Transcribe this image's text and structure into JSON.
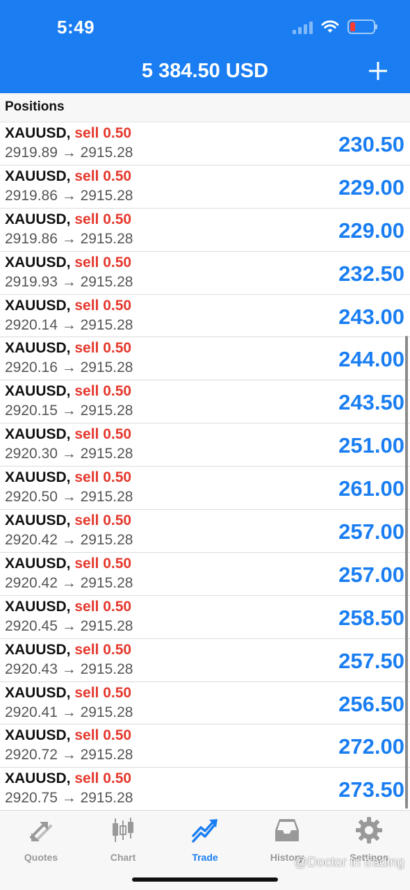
{
  "status": {
    "time": "5:49"
  },
  "header": {
    "balance": "5 384.50 USD"
  },
  "section": {
    "title": "Positions"
  },
  "positions": [
    {
      "symbol": "XAUUSD,",
      "side": "sell 0.50",
      "prices": "2919.89 → 2915.28",
      "profit": "230.50"
    },
    {
      "symbol": "XAUUSD,",
      "side": "sell 0.50",
      "prices": "2919.86 → 2915.28",
      "profit": "229.00"
    },
    {
      "symbol": "XAUUSD,",
      "side": "sell 0.50",
      "prices": "2919.86 → 2915.28",
      "profit": "229.00"
    },
    {
      "symbol": "XAUUSD,",
      "side": "sell 0.50",
      "prices": "2919.93 → 2915.28",
      "profit": "232.50"
    },
    {
      "symbol": "XAUUSD,",
      "side": "sell 0.50",
      "prices": "2920.14 → 2915.28",
      "profit": "243.00"
    },
    {
      "symbol": "XAUUSD,",
      "side": "sell 0.50",
      "prices": "2920.16 → 2915.28",
      "profit": "244.00"
    },
    {
      "symbol": "XAUUSD,",
      "side": "sell 0.50",
      "prices": "2920.15 → 2915.28",
      "profit": "243.50"
    },
    {
      "symbol": "XAUUSD,",
      "side": "sell 0.50",
      "prices": "2920.30 → 2915.28",
      "profit": "251.00"
    },
    {
      "symbol": "XAUUSD,",
      "side": "sell 0.50",
      "prices": "2920.50 → 2915.28",
      "profit": "261.00"
    },
    {
      "symbol": "XAUUSD,",
      "side": "sell 0.50",
      "prices": "2920.42 → 2915.28",
      "profit": "257.00"
    },
    {
      "symbol": "XAUUSD,",
      "side": "sell 0.50",
      "prices": "2920.42 → 2915.28",
      "profit": "257.00"
    },
    {
      "symbol": "XAUUSD,",
      "side": "sell 0.50",
      "prices": "2920.45 → 2915.28",
      "profit": "258.50"
    },
    {
      "symbol": "XAUUSD,",
      "side": "sell 0.50",
      "prices": "2920.43 → 2915.28",
      "profit": "257.50"
    },
    {
      "symbol": "XAUUSD,",
      "side": "sell 0.50",
      "prices": "2920.41 → 2915.28",
      "profit": "256.50"
    },
    {
      "symbol": "XAUUSD,",
      "side": "sell 0.50",
      "prices": "2920.72 → 2915.28",
      "profit": "272.00"
    },
    {
      "symbol": "XAUUSD,",
      "side": "sell 0.50",
      "prices": "2920.75 → 2915.28",
      "profit": "273.50"
    }
  ],
  "tabs": [
    {
      "label": "Quotes",
      "icon": "quotes-arrows-icon",
      "active": false
    },
    {
      "label": "Chart",
      "icon": "candlestick-icon",
      "active": false
    },
    {
      "label": "Trade",
      "icon": "trade-trend-icon",
      "active": true
    },
    {
      "label": "History",
      "icon": "inbox-tray-icon",
      "active": false
    },
    {
      "label": "Settings",
      "icon": "gear-icon",
      "active": false
    }
  ],
  "watermark": "@Doctor in trading",
  "colors": {
    "accent": "#1a7ef2",
    "sell": "#e5382d",
    "battery_low": "#ff3b30"
  }
}
